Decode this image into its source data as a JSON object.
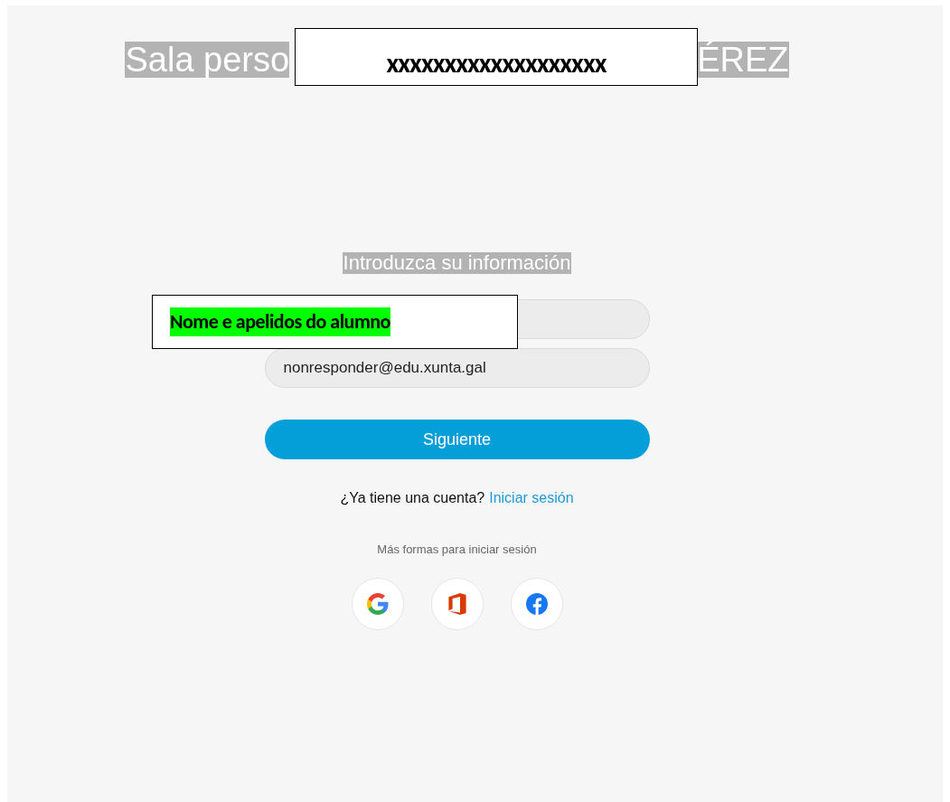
{
  "header": {
    "title_parts": [
      "Sala perso",
      "ÉREZ"
    ]
  },
  "annotations": [
    {
      "kind": "plain",
      "text": "xxxxxxxxxxxxxxxxxxx"
    },
    {
      "kind": "highlight",
      "text": "Nome e apelidos do alumno"
    }
  ],
  "form": {
    "heading": "Introduzca su información",
    "email_field": {
      "value": "nonresponder@edu.xunta.gal"
    },
    "button": "Siguiente",
    "account_prompt": "¿Ya tiene una cuenta?",
    "sign_in_link": "Iniciar sesión",
    "more_ways": "Más formas para iniciar sesión",
    "providers": [
      {
        "kind": "google"
      },
      {
        "kind": "office"
      },
      {
        "kind": "facebook"
      }
    ]
  }
}
